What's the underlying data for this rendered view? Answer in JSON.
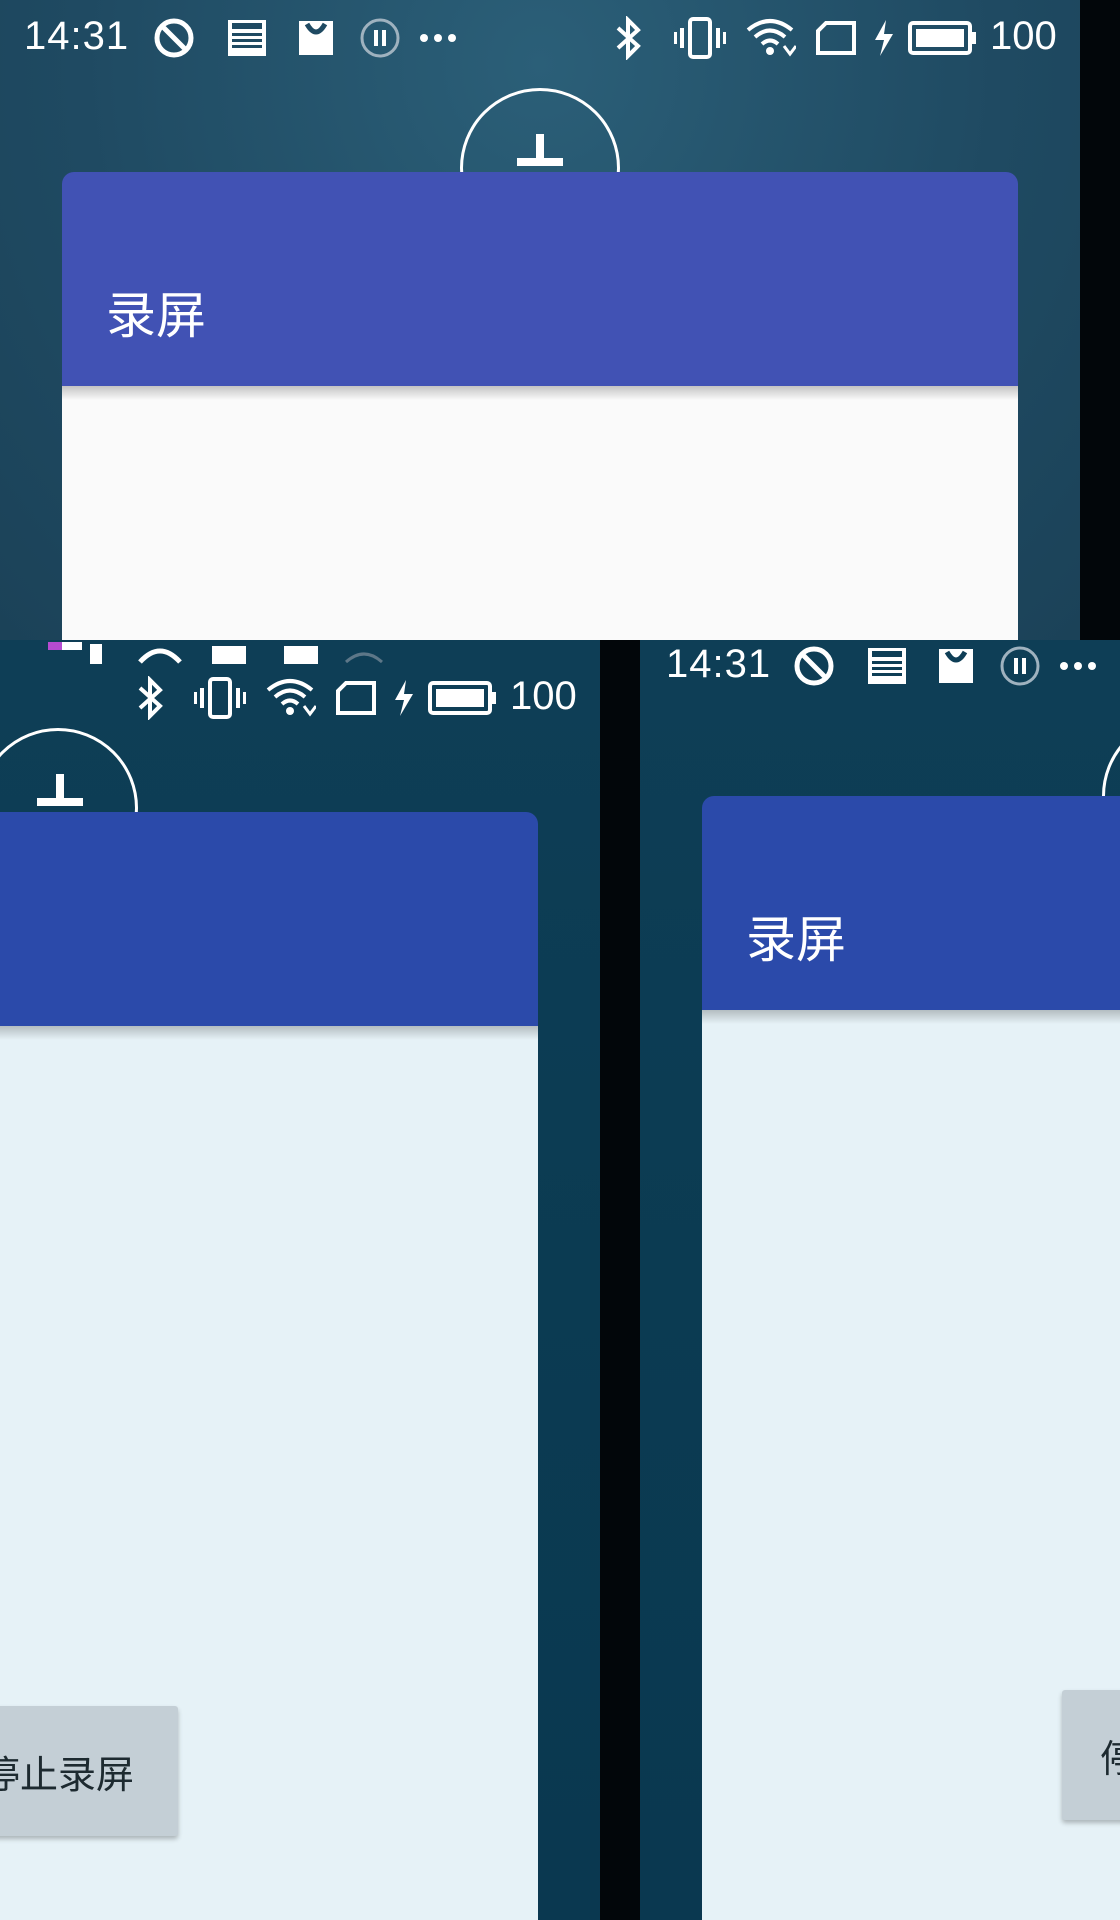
{
  "status_bar": {
    "time": "14:31",
    "battery_level": "100",
    "icons": [
      "do-not-disturb-icon",
      "news-icon",
      "shopping-bag-icon",
      "pause-circle-icon",
      "more-dots-icon",
      "bluetooth-icon",
      "vibrate-icon",
      "wifi-icon",
      "sim-card-icon",
      "charging-icon",
      "battery-icon"
    ]
  },
  "dialog": {
    "title": "录屏",
    "header_color": "#4152b4",
    "header_color_dark": "#2b4aaa",
    "body_color_light": "#fafafa",
    "body_color_tinted": "#e6f2f7"
  },
  "controls": {
    "stop_button_label": "停止录屏",
    "partial_button_label": "停"
  }
}
